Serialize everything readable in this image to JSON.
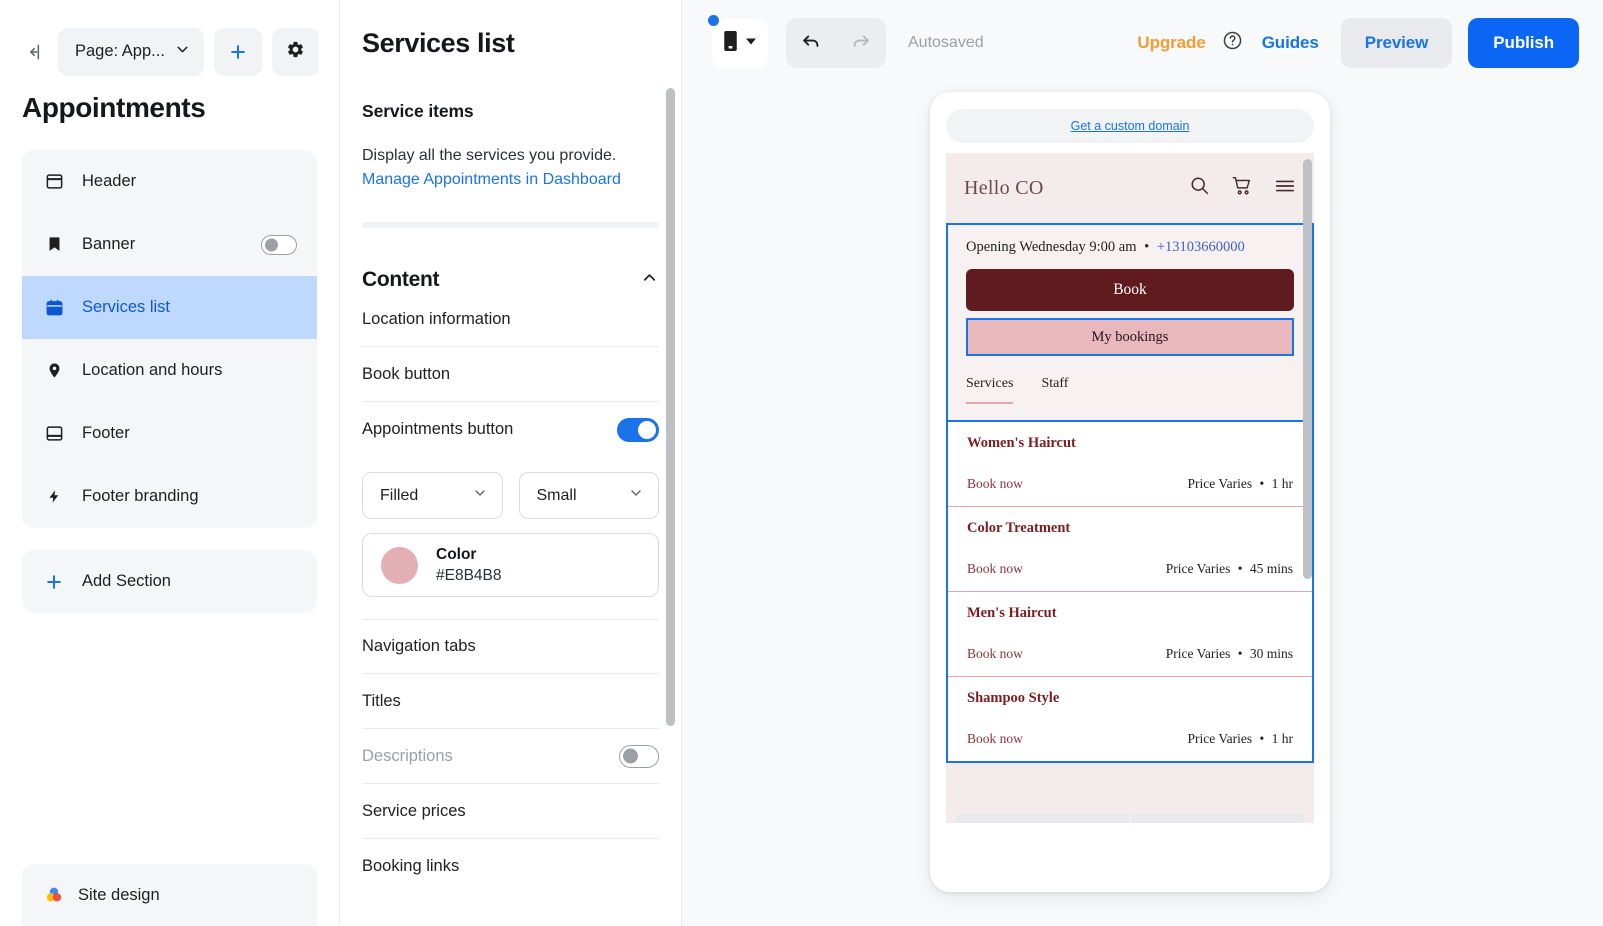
{
  "sidebar": {
    "collapse_icon": "collapse-panel-icon",
    "page_selector": {
      "label": "Page: App...",
      "chevron": "chevron-down-icon"
    },
    "add_button": "+",
    "settings_icon": "gear-icon",
    "page_title": "Appointments",
    "items": [
      {
        "label": "Header",
        "icon": "header-layout-icon",
        "active": false,
        "toggle": null
      },
      {
        "label": "Banner",
        "icon": "bookmark-icon",
        "active": false,
        "toggle": "off"
      },
      {
        "label": "Services list",
        "icon": "calendar-icon",
        "active": true,
        "toggle": null
      },
      {
        "label": "Location and hours",
        "icon": "map-pin-icon",
        "active": false,
        "toggle": null
      },
      {
        "label": "Footer",
        "icon": "footer-layout-icon",
        "active": false,
        "toggle": null
      },
      {
        "label": "Footer branding",
        "icon": "lightning-bolt-icon",
        "active": false,
        "toggle": null
      }
    ],
    "add_section": {
      "label": "Add Section",
      "icon": "plus-icon"
    },
    "site_design": {
      "label": "Site design",
      "icon": "color-palette-icon"
    }
  },
  "properties": {
    "title": "Services list",
    "service_items": {
      "heading": "Service items",
      "description": "Display all the services you provide.",
      "link": "Manage Appointments in Dashboard"
    },
    "content": {
      "heading": "Content",
      "chevron": "chevron-up-icon",
      "rows": [
        {
          "label": "Location information",
          "control": "none"
        },
        {
          "label": "Book button",
          "control": "none"
        },
        {
          "label": "Appointments button",
          "control": "toggle-on"
        }
      ],
      "style_select": {
        "value": "Filled",
        "chevron": "chevron-down-icon"
      },
      "size_select": {
        "value": "Small",
        "chevron": "chevron-down-icon"
      },
      "color": {
        "label": "Color",
        "hex": "#E8B4B8"
      },
      "rows2": [
        {
          "label": "Navigation tabs",
          "control": "none"
        },
        {
          "label": "Titles",
          "control": "none"
        },
        {
          "label": "Descriptions",
          "control": "toggle-off",
          "muted": true
        },
        {
          "label": "Service prices",
          "control": "none"
        },
        {
          "label": "Booking links",
          "control": "none"
        }
      ]
    }
  },
  "toolbar": {
    "device_icon": "mobile-device-icon",
    "device_chevron": "chevron-down-icon",
    "undo_icon": "undo-arrow-icon",
    "redo_icon": "redo-arrow-icon",
    "autosaved": "Autosaved",
    "upgrade": "Upgrade",
    "help_icon": "question-circle-icon",
    "guides": "Guides",
    "preview": "Preview",
    "publish": "Publish"
  },
  "preview": {
    "domain_cta": "Get a custom domain",
    "site_header": {
      "brand": "Hello CO",
      "icons": [
        "search-icon",
        "shopping-cart-icon",
        "hamburger-menu-icon"
      ]
    },
    "hero": {
      "opening": "Opening Wednesday 9:00 am",
      "separator": "•",
      "phone": "+13103660000",
      "book_button": "Book",
      "my_bookings_button": "My bookings"
    },
    "tabs": [
      {
        "label": "Services",
        "active": true
      },
      {
        "label": "Staff",
        "active": false
      }
    ],
    "services": [
      {
        "name": "Women's Haircut",
        "book": "Book now",
        "price": "Price Varies",
        "separator": "•",
        "duration": "1 hr"
      },
      {
        "name": "Color Treatment",
        "book": "Book now",
        "price": "Price Varies",
        "separator": "•",
        "duration": "45 mins"
      },
      {
        "name": "Men's Haircut",
        "book": "Book now",
        "price": "Price Varies",
        "separator": "•",
        "duration": "30 mins"
      },
      {
        "name": "Shampoo Style",
        "book": "Book now",
        "price": "Price Varies",
        "separator": "•",
        "duration": "1 hr"
      }
    ]
  },
  "colors": {
    "accent_blue": "#1a73e8",
    "publish_blue": "#0b66f5",
    "upgrade_orange": "#f29c38",
    "selected_row": "#bfd9fe",
    "site_maroon": "#601b1e",
    "site_pink": "#E8B4B8",
    "site_bg": "#f4ecec"
  }
}
